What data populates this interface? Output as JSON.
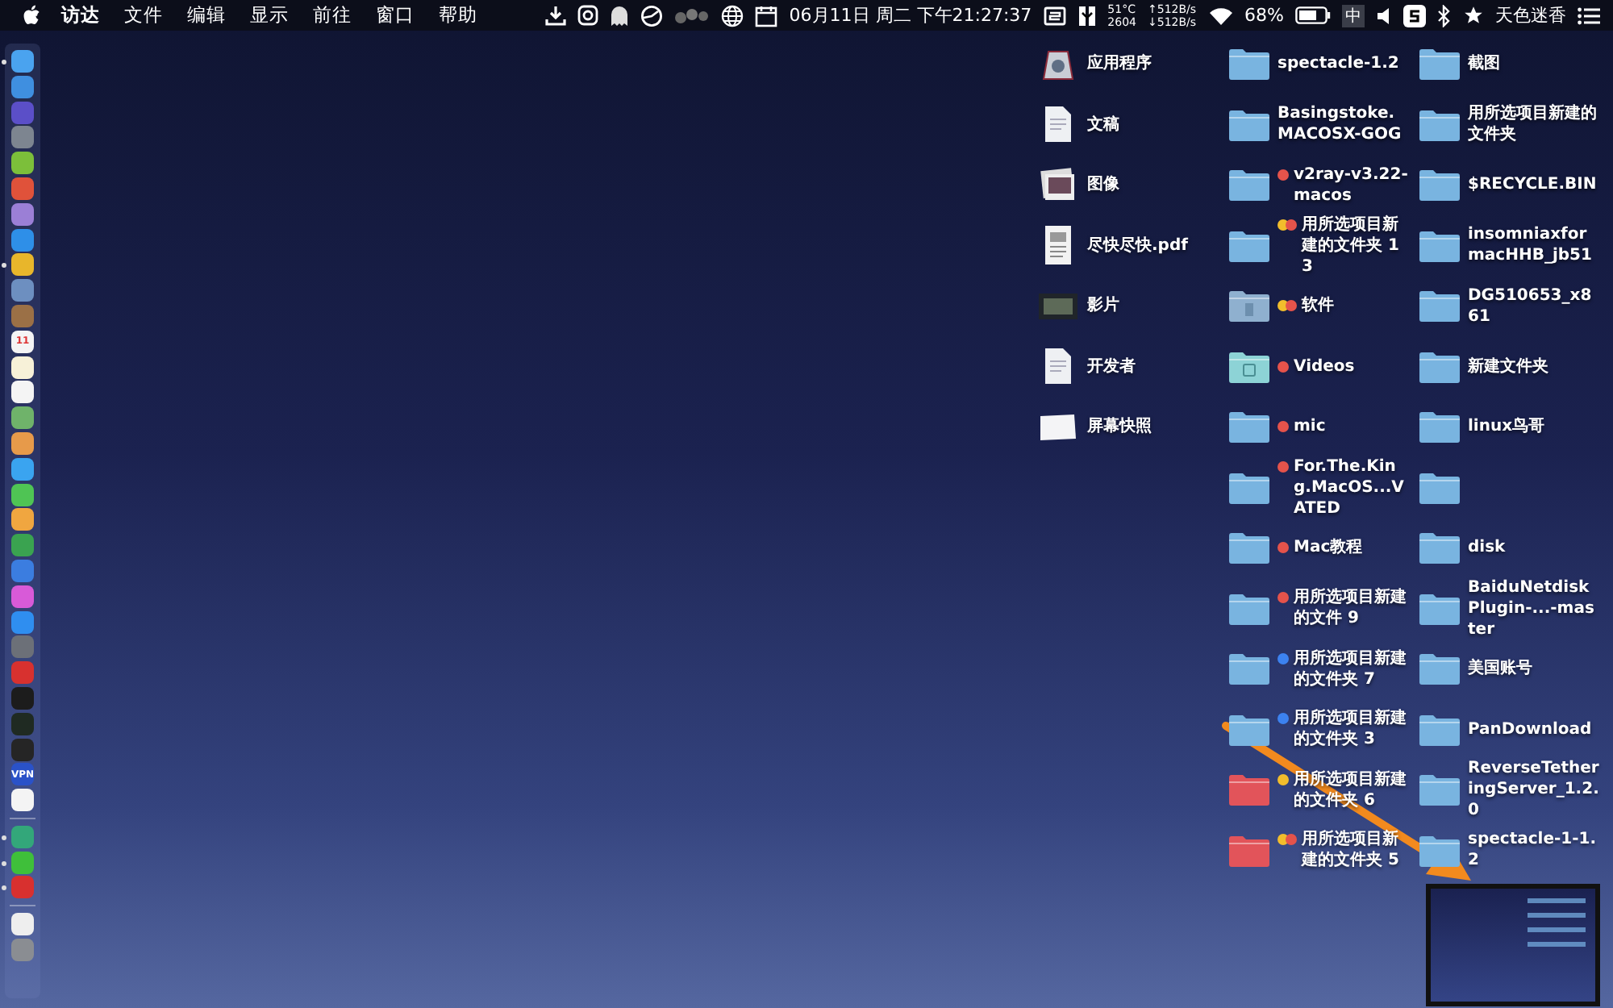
{
  "menu_bar": {
    "app_menu": "访达",
    "menus": [
      "文件",
      "编辑",
      "显示",
      "前往",
      "窗口",
      "帮助"
    ],
    "clock": "06月11日 周二 下午21:27:37",
    "temperature": "51°C",
    "fan_speed": "2604",
    "upload_rate": "↑512B/s",
    "download_rate": "↓512B/s",
    "battery_percent": "68%",
    "input_method": "中",
    "user_name": "天色迷香"
  },
  "dock": [
    {
      "color": "#4aa3ef",
      "running": true
    },
    {
      "color": "#3f8fe0"
    },
    {
      "color": "#5b4fc8"
    },
    {
      "color": "#7d8590"
    },
    {
      "color": "#7cbf3a"
    },
    {
      "color": "#e0523a"
    },
    {
      "color": "#9b7fd6"
    },
    {
      "color": "#2e8fe8"
    },
    {
      "color": "#e8b62b",
      "running": true
    },
    {
      "color": "#6d8fc0"
    },
    {
      "color": "#9b7046"
    },
    {
      "color": "#f4f4f4",
      "text": "11"
    },
    {
      "color": "#f7f1d8"
    },
    {
      "color": "#f4f4f4"
    },
    {
      "color": "#6fb36a"
    },
    {
      "color": "#e79a4a"
    },
    {
      "color": "#3aa4f0"
    },
    {
      "color": "#4fc454"
    },
    {
      "color": "#f0a640"
    },
    {
      "color": "#3aa350"
    },
    {
      "color": "#3b7de0"
    },
    {
      "color": "#d85ad8"
    },
    {
      "color": "#2f8ef0"
    },
    {
      "color": "#6c7078"
    },
    {
      "color": "#d8312f"
    },
    {
      "color": "#1c1c1c"
    },
    {
      "color": "#1f2a22"
    },
    {
      "color": "#252525"
    },
    {
      "color": "#2a52c8",
      "text": "VPN"
    },
    {
      "color": "#f4f4f4"
    },
    {
      "color": "#33a77a",
      "running": true,
      "group_start": true
    },
    {
      "color": "#3fbf3a",
      "running": true
    },
    {
      "color": "#d8302f",
      "running": true
    },
    {
      "color": "#eeeeee",
      "group_start": true
    },
    {
      "color": "#8a8d92"
    }
  ],
  "desktop": {
    "columns": [
      [
        {
          "kind": "drive",
          "label": "应用程序"
        },
        {
          "kind": "document",
          "label": "文稿"
        },
        {
          "kind": "pictures",
          "label": "图像"
        },
        {
          "kind": "pdf",
          "label": "尽快尽快.pdf"
        },
        {
          "kind": "photo",
          "label": "影片"
        },
        {
          "kind": "document",
          "label": "开发者"
        },
        {
          "kind": "blank",
          "label": "屏幕快照"
        }
      ],
      [
        {
          "kind": "folder",
          "label": "spectacle-1.2"
        },
        {
          "kind": "folder",
          "label": "Basingstoke.MACOSX-GOG"
        },
        {
          "kind": "folder",
          "label": "v2ray-v3.22-macos",
          "tags": [
            {
              "color": "#e5534b"
            }
          ]
        },
        {
          "kind": "folder",
          "label": "用所选项目新建的文件夹 13",
          "tags": [
            {
              "color": "#f2bd2c"
            },
            {
              "color": "#e5534b"
            }
          ]
        },
        {
          "kind": "media-folder",
          "label": "软件",
          "tags": [
            {
              "color": "#f2bd2c"
            },
            {
              "color": "#e5534b"
            }
          ]
        },
        {
          "kind": "teal-folder",
          "label": "Videos",
          "tags": [
            {
              "color": "#e5534b"
            }
          ]
        },
        {
          "kind": "folder",
          "label": "mic",
          "tags": [
            {
              "color": "#e5534b"
            }
          ]
        },
        {
          "kind": "folder",
          "label": "For.The.King.MacOS...VATED",
          "tags": [
            {
              "color": "#e5534b"
            }
          ]
        },
        {
          "kind": "folder",
          "label": "Mac教程",
          "tags": [
            {
              "color": "#e5534b"
            }
          ]
        },
        {
          "kind": "folder",
          "label": "用所选项目新建的文件 9",
          "tags": [
            {
              "color": "#e5534b"
            }
          ]
        },
        {
          "kind": "folder",
          "label": "用所选项目新建的文件夹 7",
          "tags": [
            {
              "color": "#3c82f0"
            }
          ]
        },
        {
          "kind": "folder",
          "label": "用所选项目新建的文件夹 3",
          "tags": [
            {
              "color": "#3c82f0"
            }
          ]
        },
        {
          "kind": "red-folder",
          "label": "用所选项目新建的文件夹 6",
          "tags": [
            {
              "color": "#f2bd2c"
            }
          ]
        },
        {
          "kind": "red-folder",
          "label": "用所选项目新建的文件夹 5",
          "tags": [
            {
              "color": "#f2bd2c"
            },
            {
              "color": "#e5534b"
            }
          ]
        }
      ],
      [
        {
          "kind": "folder",
          "label": "截图"
        },
        {
          "kind": "folder",
          "label": "用所选项目新建的文件夹"
        },
        {
          "kind": "folder",
          "label": "$RECYCLE.BIN"
        },
        {
          "kind": "folder",
          "label": "insomniaxformacHHB_jb51"
        },
        {
          "kind": "folder",
          "label": "DG510653_x861"
        },
        {
          "kind": "folder",
          "label": "新建文件夹"
        },
        {
          "kind": "folder",
          "label": "linux鸟哥"
        },
        {
          "kind": "folder"
        },
        {
          "kind": "folder",
          "label": "disk"
        },
        {
          "kind": "folder",
          "label": "BaiduNetdiskPlugin-...-master"
        },
        {
          "kind": "folder",
          "label": "美国账号"
        },
        {
          "kind": "folder",
          "label": "PanDownload"
        },
        {
          "kind": "folder",
          "label": "ReverseTetheringServer_1.2.0"
        },
        {
          "kind": "folder",
          "label": "spectacle-1-1.2"
        }
      ]
    ]
  }
}
